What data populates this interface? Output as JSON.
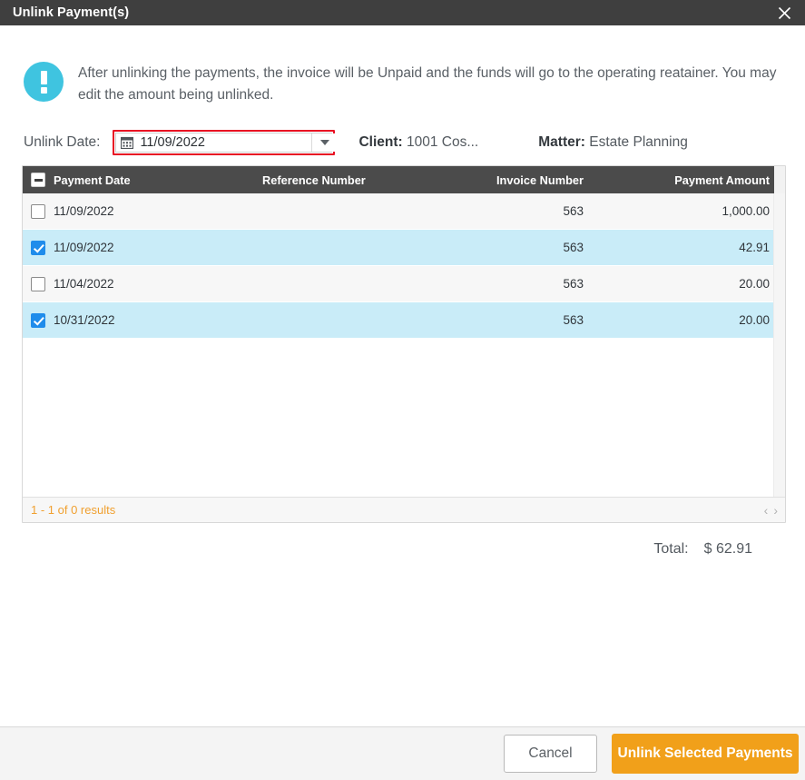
{
  "titlebar": {
    "title": "Unlink Payment(s)",
    "close_icon": "close-icon"
  },
  "notice": {
    "icon": "info-exclamation-icon",
    "message": "After unlinking the payments, the invoice will be Unpaid and the funds will go to the operating reatainer. You may edit the amount being unlinked."
  },
  "filters": {
    "unlink_date_label": "Unlink Date:",
    "unlink_date_value": "11/09/2022",
    "unlink_date_placeholder": "mm/dd/yyyy",
    "calendar_icon": "calendar-icon",
    "dropdown_icon": "chevron-down-icon",
    "client_label": "Client:",
    "client_value": "1001 Cos...",
    "matter_label": "Matter:",
    "matter_value": "Estate Planning"
  },
  "grid": {
    "columns": {
      "payment_date": "Payment Date",
      "reference_number": "Reference Number",
      "invoice_number": "Invoice Number",
      "payment_amount": "Payment Amount"
    },
    "header_checkbox_state": "indeterminate",
    "rows": [
      {
        "selected": false,
        "payment_date": "11/09/2022",
        "reference_number": "",
        "invoice_number": "563",
        "payment_amount": "1,000.00"
      },
      {
        "selected": true,
        "payment_date": "11/09/2022",
        "reference_number": "",
        "invoice_number": "563",
        "payment_amount": "42.91"
      },
      {
        "selected": false,
        "payment_date": "11/04/2022",
        "reference_number": "",
        "invoice_number": "563",
        "payment_amount": "20.00"
      },
      {
        "selected": true,
        "payment_date": "10/31/2022",
        "reference_number": "",
        "invoice_number": "563",
        "payment_amount": "20.00"
      }
    ],
    "footer": {
      "results_text": "1 - 1 of 0 results",
      "prev_icon": "chevron-left-icon",
      "prev_glyph": "‹",
      "next_icon": "chevron-right-icon",
      "next_glyph": "›"
    }
  },
  "total": {
    "label": "Total:",
    "value": "$ 62.91"
  },
  "footer": {
    "cancel_label": "Cancel",
    "primary_label": "Unlink Selected Payments"
  },
  "colors": {
    "titlebar_bg": "#3f3f3f",
    "grid_header_bg": "#4b4b4b",
    "row_selected_bg": "#c9ecf8",
    "checkbox_checked": "#1f8ceb",
    "validation_border": "#e81123",
    "primary_button": "#f1a01a",
    "info_icon": "#3fc4e0",
    "results_text": "#f0a030"
  }
}
